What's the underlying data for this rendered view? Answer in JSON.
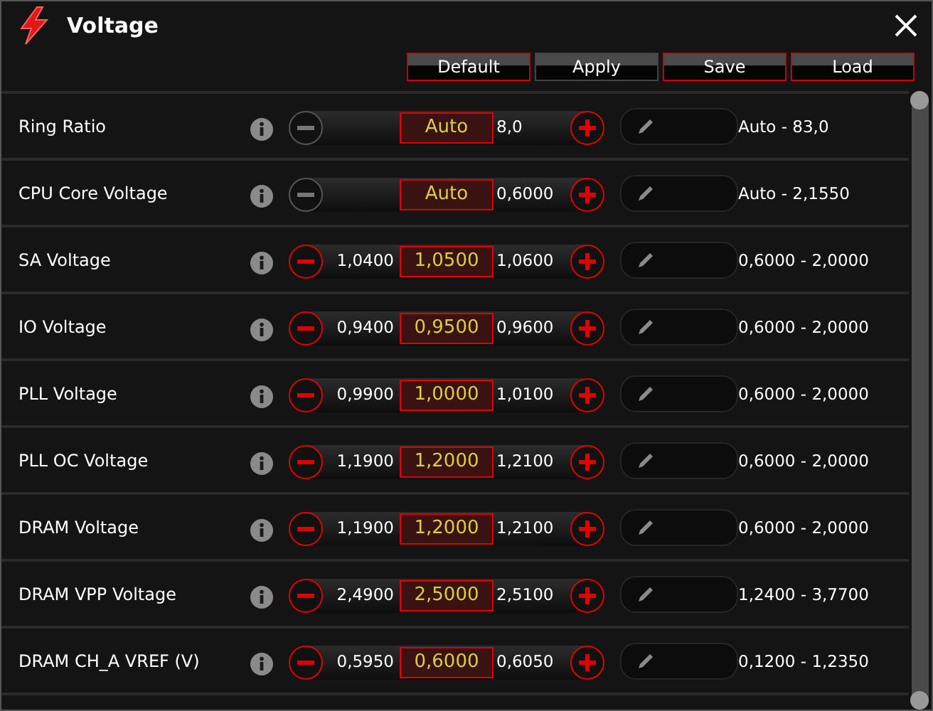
{
  "window": {
    "title": "Voltage"
  },
  "buttons": [
    {
      "label": "Default",
      "highlighted": true
    },
    {
      "label": "Apply",
      "highlighted": false
    },
    {
      "label": "Save",
      "highlighted": true
    },
    {
      "label": "Load",
      "highlighted": true
    }
  ],
  "rows": [
    {
      "label": "Ring Ratio",
      "minus_enabled": false,
      "value": "Auto",
      "upper": "8,0",
      "range": "Auto - 83,0"
    },
    {
      "label": "CPU Core Voltage",
      "minus_enabled": false,
      "value": "Auto",
      "upper": "0,6000",
      "range": "Auto - 2,1550"
    },
    {
      "label": "SA Voltage",
      "minus_enabled": true,
      "lower": "1,0400",
      "value": "1,0500",
      "upper": "1,0600",
      "range": "0,6000 - 2,0000"
    },
    {
      "label": "IO Voltage",
      "minus_enabled": true,
      "lower": "0,9400",
      "value": "0,9500",
      "upper": "0,9600",
      "range": "0,6000 - 2,0000"
    },
    {
      "label": "PLL Voltage",
      "minus_enabled": true,
      "lower": "0,9900",
      "value": "1,0000",
      "upper": "1,0100",
      "range": "0,6000 - 2,0000"
    },
    {
      "label": "PLL OC Voltage",
      "minus_enabled": true,
      "lower": "1,1900",
      "value": "1,2000",
      "upper": "1,2100",
      "range": "0,6000 - 2,0000"
    },
    {
      "label": "DRAM Voltage",
      "minus_enabled": true,
      "lower": "1,1900",
      "value": "1,2000",
      "upper": "1,2100",
      "range": "0,6000 - 2,0000"
    },
    {
      "label": "DRAM VPP Voltage",
      "minus_enabled": true,
      "lower": "2,4900",
      "value": "2,5000",
      "upper": "2,5100",
      "range": "1,2400 - 3,7700"
    },
    {
      "label": "DRAM CH_A VREF (V)",
      "minus_enabled": true,
      "lower": "0,5950",
      "value": "0,6000",
      "upper": "0,6050",
      "range": "0,1200 - 1,2350"
    }
  ]
}
